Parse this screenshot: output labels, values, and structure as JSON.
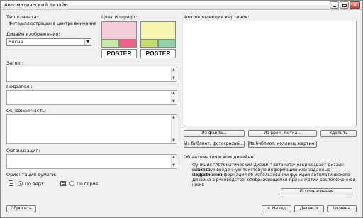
{
  "window": {
    "title": "Автоматический дизайн"
  },
  "left": {
    "poster_type_label": "Тип плаката:",
    "poster_type_value": "Фото/иллюстрации в центре внимания",
    "image_design_label": "Дизайн изображения:",
    "image_design_value": "Весна",
    "header_label": "Загол.:",
    "subheader_label": "Подзагол.:",
    "body_label": "Основная часть:",
    "org_label": "Организация:",
    "orientation_label": "Ориентация бумаги:",
    "portrait_label": "По верт.",
    "landscape_label": "По гориз.",
    "portrait_selected": true
  },
  "color_font": {
    "label": "Цвет и шрифт:",
    "themes": [
      {
        "poster_text": "POSTER",
        "main": "#f6cbd8",
        "left": "#c8e8a8",
        "right": "#f2608a"
      },
      {
        "poster_text": "POSTER",
        "main": "#f6f6b0",
        "left": "#c3dd6e",
        "right": "#90d3a8"
      }
    ]
  },
  "pictures": {
    "label": "Фото/коллекция картинок:",
    "buttons": {
      "from_file": "Из файла...",
      "from_temp": "Из врем. потка...",
      "delete": "Удалить",
      "from_photo_lib": "Из библиот. фотографий...",
      "from_clip_lib": "Из библиот. коллекц. картин..."
    }
  },
  "about": {
    "heading": "Об автоматическом дизайне",
    "lines": [
      "Функция \"Автоматический дизайн\" автоматически создает дизайн плаката,",
      "используя введенную текстовую информацию или заданные изображения.",
      "Подробная информация об использовании функции автоматического",
      "дизайна в руководстве, отображающемся при нажатии расположенной ниже"
    ],
    "usage_button": "Использование"
  },
  "footer": {
    "reset": "Сбросить",
    "back": "< Назад",
    "next": "Далее >",
    "cancel": "Отмена"
  }
}
